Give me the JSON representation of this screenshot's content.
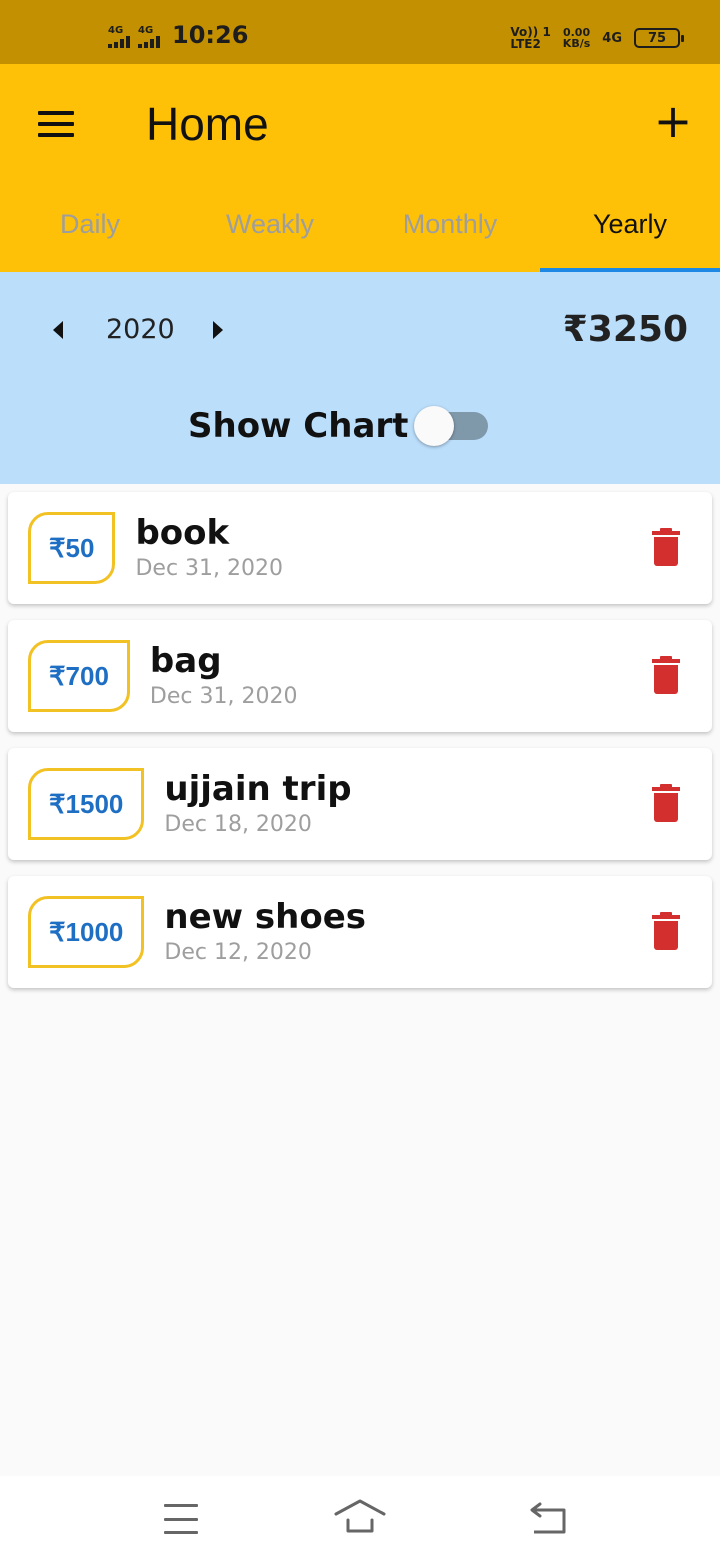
{
  "status_bar": {
    "sim1_label": "4G",
    "sim2_label": "4G",
    "time": "10:26",
    "volte_top": "Vo)) 1",
    "volte_bottom": "LTE2",
    "speed_value": "0.00",
    "speed_unit": "KB/s",
    "network": "4G",
    "battery": "75"
  },
  "app_bar": {
    "title": "Home",
    "add_label": "+"
  },
  "tabs": [
    {
      "label": "Daily",
      "active": false
    },
    {
      "label": "Weakly",
      "active": false
    },
    {
      "label": "Monthly",
      "active": false
    },
    {
      "label": "Yearly",
      "active": true
    }
  ],
  "summary": {
    "year": "2020",
    "total": "₹3250",
    "chart_toggle_label": "Show Chart",
    "chart_toggle_on": false
  },
  "transactions": [
    {
      "amount": "₹50",
      "name": "book",
      "date": "Dec 31, 2020"
    },
    {
      "amount": "₹700",
      "name": "bag",
      "date": "Dec 31, 2020"
    },
    {
      "amount": "₹1500",
      "name": "ujjain trip",
      "date": "Dec 18, 2020"
    },
    {
      "amount": "₹1000",
      "name": "new shoes",
      "date": "Dec 12, 2020"
    }
  ],
  "icons": {
    "menu": "menu-icon",
    "add": "plus-icon",
    "prev": "triangle-left-icon",
    "next": "triangle-right-icon",
    "delete": "trash-icon",
    "nav_menu": "menu-lines-icon",
    "nav_home": "home-icon",
    "nav_back": "back-arrow-icon"
  },
  "colors": {
    "status_bar": "#c29000",
    "app_bar": "#ffc107",
    "tab_indicator": "#1e88e5",
    "summary_bg": "#bbdefb",
    "amount_border": "#f2c224",
    "amount_text": "#1e6fc4",
    "delete": "#d32f2f"
  }
}
